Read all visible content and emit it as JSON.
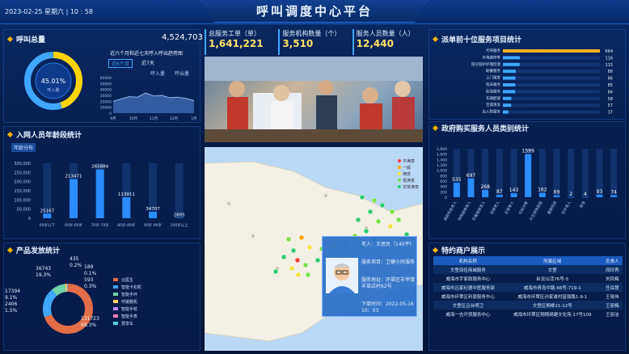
{
  "header": {
    "title": "呼叫调度中心平台",
    "datetime": "2023-02-25 星期六 | 10 : 58"
  },
  "call_total": {
    "title": "呼叫总量",
    "value": "4,524,703",
    "percent": "45.01%",
    "gauge_label": "呼入量",
    "trend_label": "近六个月和近七天呼入呼出趋势图",
    "tab_six_months": "近6个月",
    "tab_seven_days": "近7天",
    "legend_in": "呼入量",
    "legend_out": "呼出量",
    "yticks": [
      "60000",
      "50000",
      "40000",
      "30000",
      "20000",
      "10000",
      "0"
    ],
    "xticks": [
      "9月",
      "10月",
      "11月",
      "12月",
      "1月"
    ],
    "trend": [
      20000,
      24000,
      28000,
      27000,
      34000,
      29000,
      30000,
      26000,
      27000,
      25000,
      21000
    ]
  },
  "age_stats": {
    "title": "入网人员年龄段统计",
    "tab": "年龄分布",
    "chart_data": {
      "type": "bar",
      "categories": [
        "60岁以下",
        "60岁-69岁",
        "70岁-79岁",
        "80岁-89岁",
        "90岁-99岁",
        "100岁以上"
      ],
      "values": [
        25167,
        213471,
        265884,
        113911,
        34707,
        2805
      ],
      "ylim": [
        0,
        300000
      ],
      "yticks": [
        "300,000",
        "250,000",
        "200,000",
        "150,000",
        "100,000",
        "50,000",
        "0"
      ]
    }
  },
  "product": {
    "title": "产品发放统计",
    "chart_data": {
      "type": "pie",
      "labels": [
        "云医生",
        "智能卡扣机",
        "智能手环",
        "呼援腕机",
        "智能手杖",
        "智能手表",
        "慧享车"
      ],
      "values": [
        131723,
        36743,
        17394,
        2406,
        435,
        189,
        593
      ],
      "percents": [
        "69.3%",
        "19.3%",
        "9.1%",
        "1.5%",
        "0.2%",
        "0.1%",
        "0.3%"
      ],
      "colors": [
        "#e26d48",
        "#3fa7ff",
        "#6fd3a8",
        "#ffd166",
        "#b48cff",
        "#ff7eb6",
        "#4dd0e1"
      ]
    },
    "annotations": [
      "36743",
      "19.3%",
      "435",
      "0.2%",
      "189",
      "0.1%",
      "593",
      "0.3%",
      "17394",
      "9.1%",
      "2406",
      "1.5%",
      "131723",
      "69.3%"
    ]
  },
  "kpis": [
    {
      "label": "总服务工单（单）",
      "value": "1,641,221"
    },
    {
      "label": "服务机构数量（个）",
      "value": "3,510"
    },
    {
      "label": "服务人员数量（人）",
      "value": "12,440"
    }
  ],
  "map": {
    "legend": [
      "不满意",
      "一般",
      "满意",
      "很满意",
      "非常满意"
    ],
    "legend_colors": [
      "#ff3b3b",
      "#ffa500",
      "#f5e342",
      "#7ee04a",
      "#2ecc71"
    ],
    "popup": {
      "name": "老人：王思民（140平）",
      "item": "服务项目：卫健小时服务",
      "addr": "服务地址：环翠区羊亭镇羊草店村62号",
      "time": "下单时间：2022-05-16 10：03"
    }
  },
  "top_services": {
    "title": "派单前十位服务项目统计",
    "chart_data": {
      "type": "bar",
      "categories": [
        "代驾服务",
        "水电维修等",
        "陪诊陪护护理检测",
        "助餐服务",
        "上门理发",
        "陪床服务",
        "助浴服务",
        "车辆配速",
        "空调清洗",
        "出入院服务"
      ],
      "values": [
        664,
        116,
        115,
        88,
        86,
        85,
        84,
        58,
        57,
        37
      ]
    }
  },
  "gov_staff": {
    "title": "政府购买服务人员类别统计",
    "chart_data": {
      "type": "bar",
      "categories": [
        "高龄失能老人",
        "特殊困难老人",
        "空巢独居老人",
        "低保老人",
        "五保老人",
        "优抚对象",
        "计生特殊家庭",
        "重度残疾",
        "百岁老人",
        "其他"
      ],
      "values": [
        535,
        697,
        268,
        87,
        143,
        1599,
        162,
        69,
        2,
        4,
        93,
        74
      ],
      "yticks": [
        "1,800",
        "1,600",
        "1,400",
        "1,200",
        "1,000",
        "800",
        "600",
        "400",
        "200",
        "0"
      ]
    }
  },
  "merchants": {
    "title": "特约商户展示",
    "columns": [
      "机构名称",
      "所属区域",
      "负责人"
    ],
    "rows": [
      [
        "文登润佳商城服务",
        "文登",
        "阎玲秀"
      ],
      [
        "威海市宇家政服务中心",
        "卧龙山活76号-5",
        "刘凤梅"
      ],
      [
        "威海市吕家纪德中医服务部",
        "威海市青岛中路-66号-719-1",
        "任岳慧"
      ],
      [
        "威海市环翠区利豪服务中心",
        "威海市环翠区孙家滩村富强路1-9-1",
        "王晓伟"
      ],
      [
        "文登区吕台明卫",
        "文登区杨柳21-12号",
        "王丽梅"
      ],
      [
        "威海一吉开贸服务中心",
        "威海市环翠区翔翔胡建文化苑-17号109",
        "王丽洁"
      ]
    ]
  }
}
